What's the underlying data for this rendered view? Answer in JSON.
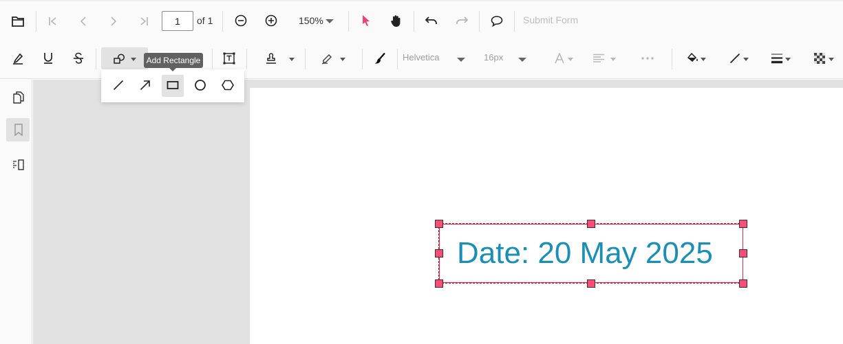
{
  "toolbar": {
    "page_number": "1",
    "page_of": "of 1",
    "zoom": "150%",
    "submit_form": "Submit Form",
    "font_name": "Helvetica",
    "font_size": "16px"
  },
  "tooltip": {
    "text": "Add Rectangle"
  },
  "annotation": {
    "text": "Date: 20 May 2025"
  },
  "colors": {
    "accent_pink": "#e9437a",
    "annotation_text": "#1a8fb3",
    "selection_border": "#e0284b",
    "handle_fill": "#ff4d79"
  },
  "icons": {
    "toolbar1": [
      "open-folder-icon",
      "first-page-icon",
      "previous-page-icon",
      "next-page-icon",
      "last-page-icon",
      "zoom-out-icon",
      "zoom-in-icon",
      "zoom-dropdown-icon",
      "text-select-icon",
      "pan-hand-icon",
      "undo-icon",
      "redo-icon",
      "comment-icon"
    ],
    "toolbar2": [
      "highlight-icon",
      "underline-icon",
      "strikethrough-icon",
      "shapes-icon",
      "calibrate-icon",
      "free-text-icon",
      "stamp-icon",
      "signature-icon",
      "ink-icon",
      "font-color-icon",
      "text-align-icon",
      "more-options-icon",
      "fill-color-icon",
      "stroke-color-icon",
      "thickness-icon",
      "opacity-icon"
    ],
    "shape_popup": [
      "line-icon",
      "arrow-icon",
      "rectangle-icon",
      "circle-icon",
      "polygon-icon"
    ],
    "sidebar": [
      "page-thumbnails-icon",
      "bookmarks-icon",
      "annotations-panel-icon"
    ]
  }
}
